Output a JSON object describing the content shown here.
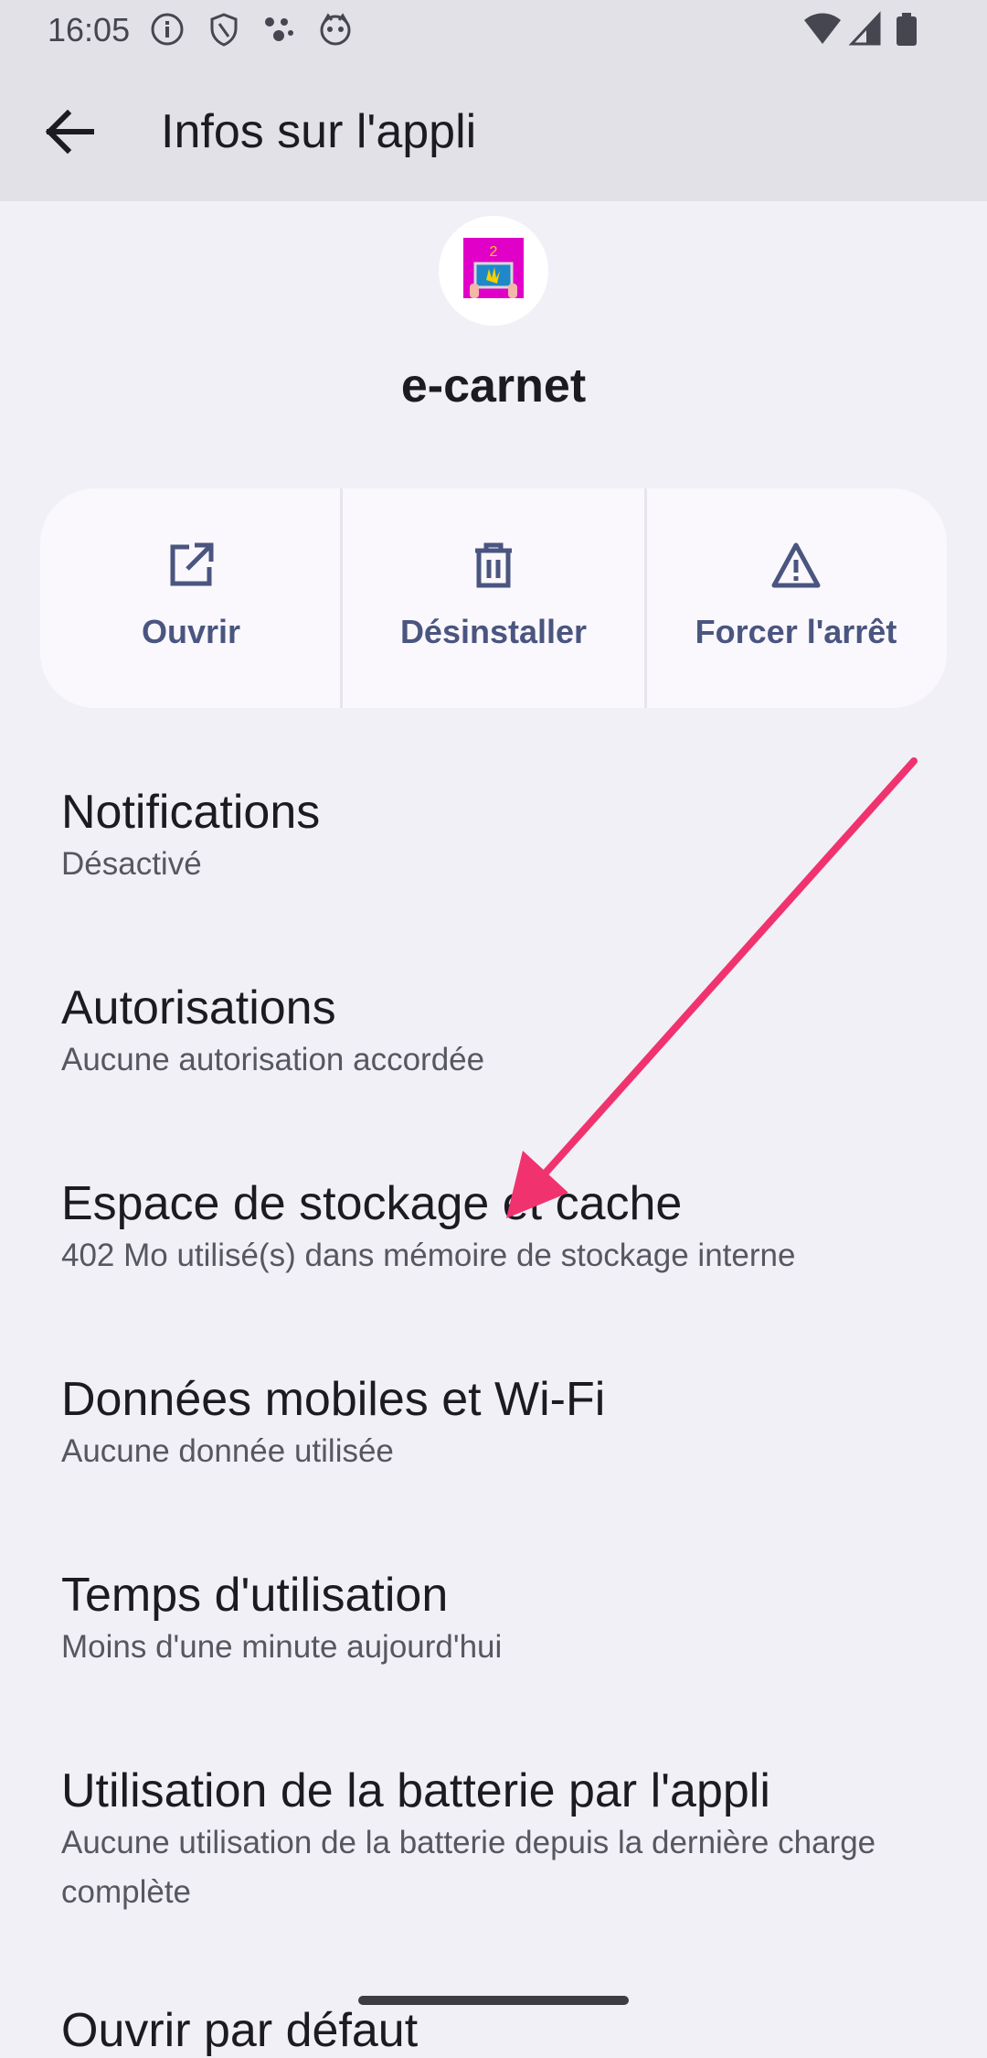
{
  "status_bar": {
    "time": "16:05",
    "left_icons": [
      "info-icon",
      "shield-icon",
      "dots-icon",
      "face-icon"
    ],
    "right_icons": [
      "wifi-icon",
      "signal-icon",
      "battery-icon"
    ]
  },
  "app_bar": {
    "back_icon": "arrow-back-icon",
    "title": "Infos sur l'appli"
  },
  "app": {
    "name": "e-carnet"
  },
  "actions": [
    {
      "icon": "open-external-icon",
      "label": "Ouvrir"
    },
    {
      "icon": "trash-icon",
      "label": "Désinstaller"
    },
    {
      "icon": "warning-icon",
      "label": "Forcer l'arrêt"
    }
  ],
  "settings": [
    {
      "title": "Notifications",
      "subtitle": "Désactivé"
    },
    {
      "title": "Autorisations",
      "subtitle": "Aucune autorisation accordée"
    },
    {
      "title": "Espace de stockage et cache",
      "subtitle": "402 Mo utilisé(s) dans mémoire de stockage interne"
    },
    {
      "title": "Données mobiles et Wi-Fi",
      "subtitle": "Aucune donnée utilisée"
    },
    {
      "title": "Temps d'utilisation",
      "subtitle": "Moins d'une minute aujourd'hui"
    },
    {
      "title": "Utilisation de la batterie par l'appli",
      "subtitle": "Aucune utilisation de la batterie depuis la dernière charge complète"
    },
    {
      "title": "Ouvrir par défaut",
      "subtitle": ""
    }
  ],
  "colors": {
    "accent": "#4a5580",
    "annotation_arrow": "#f0336f",
    "background": "#f1f0f6"
  }
}
